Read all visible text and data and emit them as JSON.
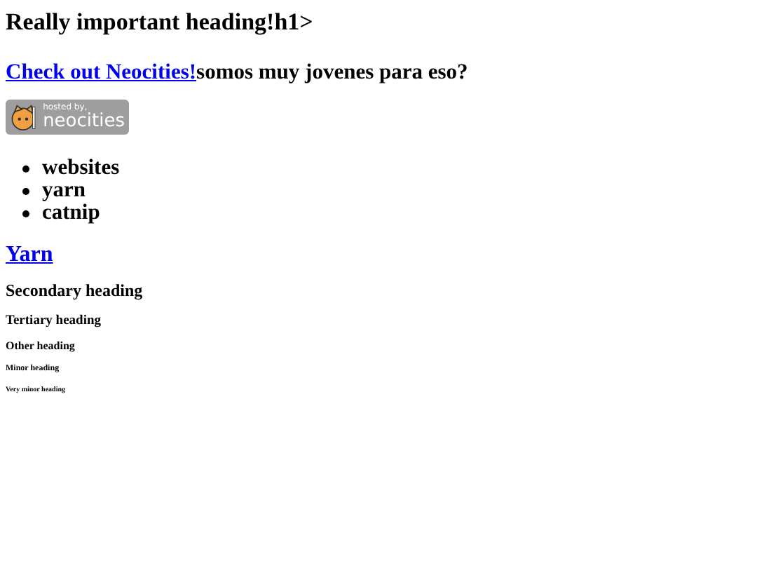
{
  "heading": "Really important heading!h1>",
  "intro": {
    "link": "Check out Neocities!",
    "text": "somos muy jovenes para eso?"
  },
  "badge": {
    "line_1": "hosted by,",
    "line_2": "neocities"
  },
  "list": [
    "websites",
    "yarn",
    "catnip"
  ],
  "yarn_link": "Yarn",
  "headings": [
    {
      "kind": "h2",
      "text": "Secondary heading"
    },
    {
      "kind": "h3",
      "text": "Tertiary heading"
    },
    {
      "kind": "h4",
      "text": "Other heading"
    },
    {
      "kind": "h5",
      "text": "Minor heading"
    },
    {
      "kind": "h6",
      "text": "Very minor heading"
    }
  ]
}
